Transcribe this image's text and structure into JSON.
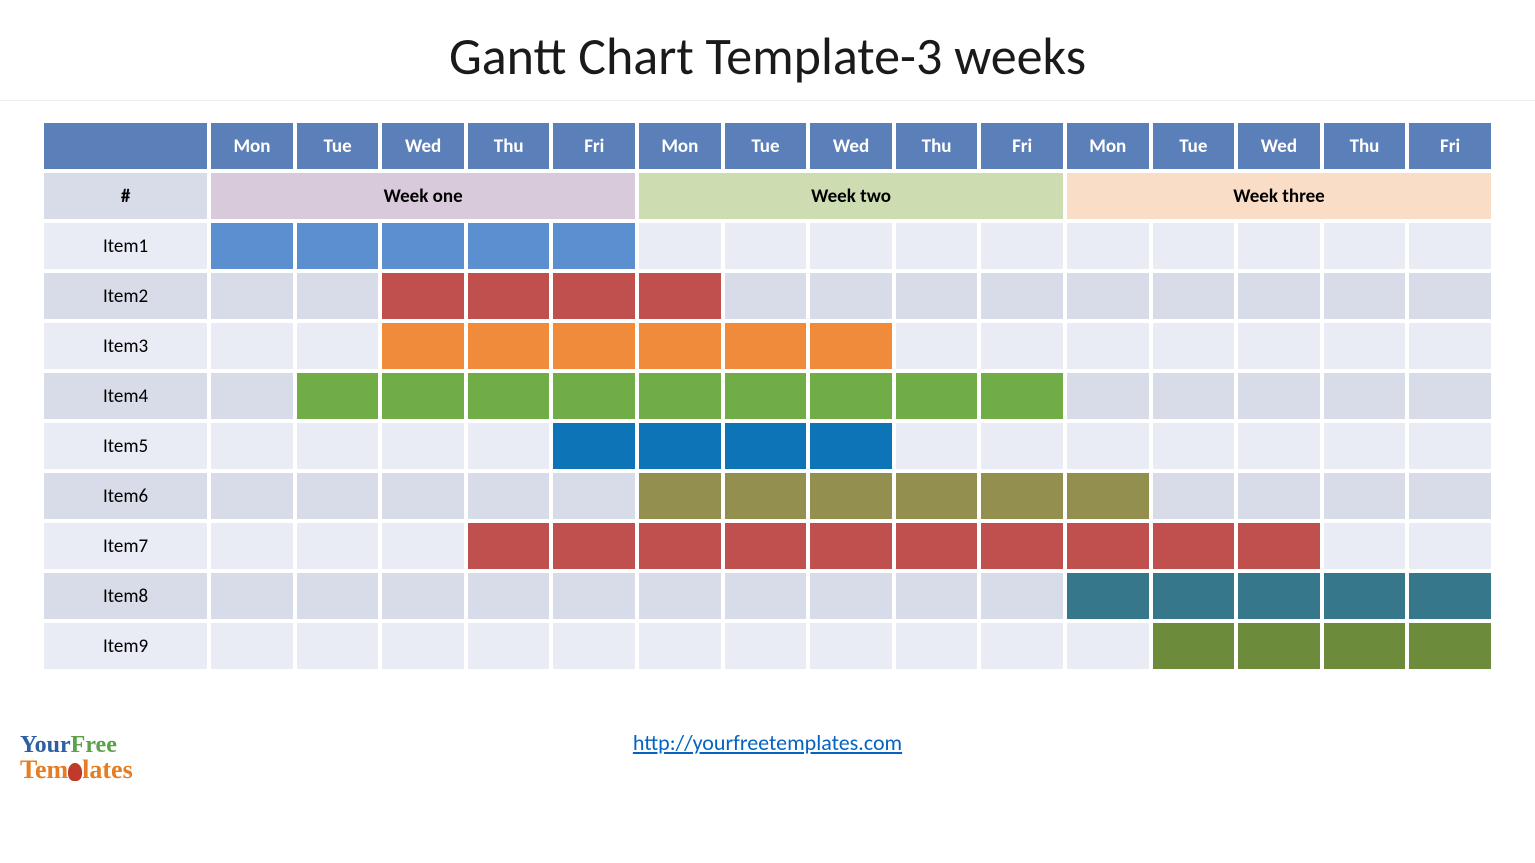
{
  "title": "Gantt Chart Template-3 weeks",
  "hash_header": "#",
  "days": [
    "Mon",
    "Tue",
    "Wed",
    "Thu",
    "Fri",
    "Mon",
    "Tue",
    "Wed",
    "Thu",
    "Fri",
    "Mon",
    "Tue",
    "Wed",
    "Thu",
    "Fri"
  ],
  "weeks": [
    {
      "label": "Week one",
      "span": 5,
      "bg": "#d9cadb"
    },
    {
      "label": "Week two",
      "span": 5,
      "bg": "#cddcb1"
    },
    {
      "label": "Week three",
      "span": 5,
      "bg": "#f9ddc6"
    }
  ],
  "items": [
    {
      "label": "Item1",
      "start": 1,
      "end": 5,
      "color": "#5b8fd0"
    },
    {
      "label": "Item2",
      "start": 3,
      "end": 6,
      "color": "#c0504d"
    },
    {
      "label": "Item3",
      "start": 3,
      "end": 8,
      "color": "#ef8b3b"
    },
    {
      "label": "Item4",
      "start": 2,
      "end": 10,
      "color": "#71ad47"
    },
    {
      "label": "Item5",
      "start": 5,
      "end": 8,
      "color": "#0e74b8"
    },
    {
      "label": "Item6",
      "start": 6,
      "end": 11,
      "color": "#938f4f"
    },
    {
      "label": "Item7",
      "start": 4,
      "end": 13,
      "color": "#c0504d"
    },
    {
      "label": "Item8",
      "start": 11,
      "end": 15,
      "color": "#36778c"
    },
    {
      "label": "Item9",
      "start": 12,
      "end": 15,
      "color": "#6c8c3c"
    }
  ],
  "footer_link_text": "http://yourfreetemplates.com",
  "logo": {
    "line1a": "Your",
    "line1b": "Free",
    "line2": "Tem  lates"
  },
  "chart_data": {
    "type": "gantt",
    "title": "Gantt Chart Template-3 weeks",
    "x_categories": [
      "Mon",
      "Tue",
      "Wed",
      "Thu",
      "Fri",
      "Mon",
      "Tue",
      "Wed",
      "Thu",
      "Fri",
      "Mon",
      "Tue",
      "Wed",
      "Thu",
      "Fri"
    ],
    "x_groups": [
      {
        "label": "Week one",
        "start": 1,
        "end": 5
      },
      {
        "label": "Week two",
        "start": 6,
        "end": 10
      },
      {
        "label": "Week three",
        "start": 11,
        "end": 15
      }
    ],
    "series": [
      {
        "name": "Item1",
        "start": 1,
        "end": 5,
        "color": "#5b8fd0"
      },
      {
        "name": "Item2",
        "start": 3,
        "end": 6,
        "color": "#c0504d"
      },
      {
        "name": "Item3",
        "start": 3,
        "end": 8,
        "color": "#ef8b3b"
      },
      {
        "name": "Item4",
        "start": 2,
        "end": 10,
        "color": "#71ad47"
      },
      {
        "name": "Item5",
        "start": 5,
        "end": 8,
        "color": "#0e74b8"
      },
      {
        "name": "Item6",
        "start": 6,
        "end": 11,
        "color": "#938f4f"
      },
      {
        "name": "Item7",
        "start": 4,
        "end": 13,
        "color": "#c0504d"
      },
      {
        "name": "Item8",
        "start": 11,
        "end": 15,
        "color": "#36778c"
      },
      {
        "name": "Item9",
        "start": 12,
        "end": 15,
        "color": "#6c8c3c"
      }
    ],
    "xlim": [
      1,
      15
    ]
  }
}
